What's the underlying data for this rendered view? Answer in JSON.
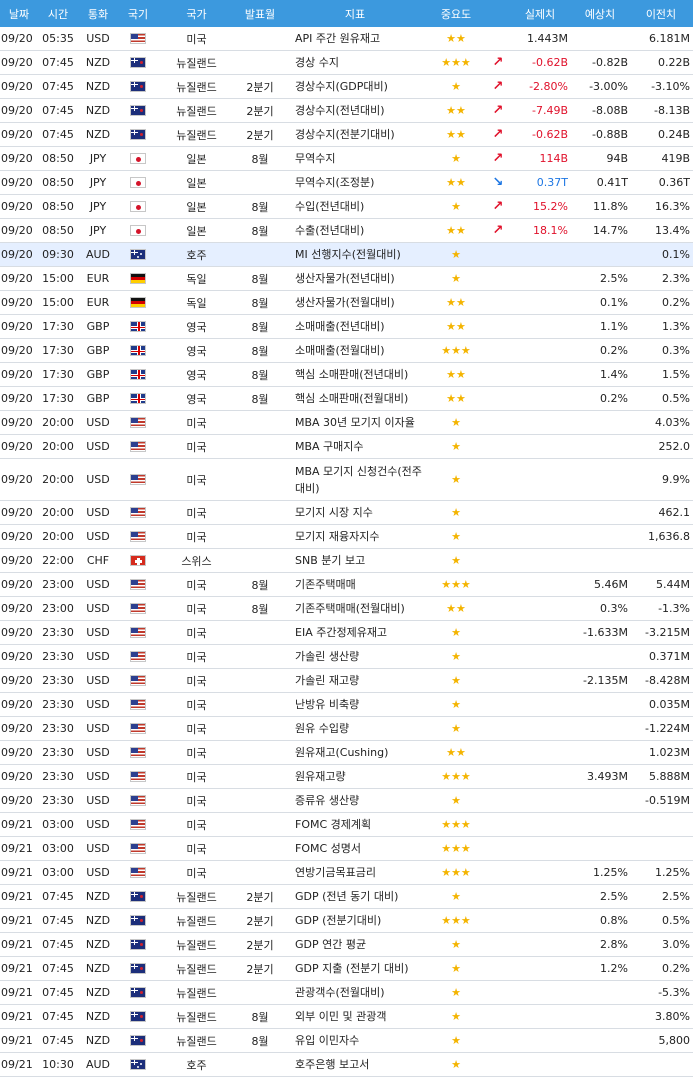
{
  "headers": {
    "date": "날짜",
    "time": "시간",
    "currency": "통화",
    "flag": "국기",
    "country": "국가",
    "period": "발표월",
    "indicator": "지표",
    "importance": "중요도",
    "actual": "실제치",
    "forecast": "예상치",
    "previous": "이전치"
  },
  "colors": {
    "header_bg": "#3c99de",
    "up": "#e0112b",
    "down": "#1d76e3",
    "star": "#f4b400",
    "highlight_row": "#e5efff"
  },
  "rows": [
    {
      "date": "09/20",
      "time": "05:35",
      "cur": "USD",
      "flag": "us-flag",
      "country": "미국",
      "period": "",
      "ind": "API 주간 원유재고",
      "imp": "★★",
      "trend": "",
      "act": "1.443M",
      "fc": "",
      "prev": "6.181M",
      "h": 24
    },
    {
      "date": "09/20",
      "time": "07:45",
      "cur": "NZD",
      "flag": "nz-flag",
      "country": "뉴질랜드",
      "period": "",
      "ind": "경상 수지",
      "imp": "★★★",
      "trend": "up",
      "act": "-0.62B",
      "fc": "-0.82B",
      "prev": "0.22B",
      "h": 24
    },
    {
      "date": "09/20",
      "time": "07:45",
      "cur": "NZD",
      "flag": "nz-flag",
      "country": "뉴질랜드",
      "period": "2분기",
      "ind": "경상수지(GDP대비)",
      "imp": "★",
      "trend": "up",
      "act": "-2.80%",
      "fc": "-3.00%",
      "prev": "-3.10%",
      "h": 24
    },
    {
      "date": "09/20",
      "time": "07:45",
      "cur": "NZD",
      "flag": "nz-flag",
      "country": "뉴질랜드",
      "period": "2분기",
      "ind": "경상수지(전년대비)",
      "imp": "★★",
      "trend": "up",
      "act": "-7.49B",
      "fc": "-8.08B",
      "prev": "-8.13B",
      "h": 24
    },
    {
      "date": "09/20",
      "time": "07:45",
      "cur": "NZD",
      "flag": "nz-flag",
      "country": "뉴질랜드",
      "period": "2분기",
      "ind": "경상수지(전분기대비)",
      "imp": "★★",
      "trend": "up",
      "act": "-0.62B",
      "fc": "-0.88B",
      "prev": "0.24B",
      "h": 24
    },
    {
      "date": "09/20",
      "time": "08:50",
      "cur": "JPY",
      "flag": "jp-flag",
      "country": "일본",
      "period": "8월",
      "ind": "무역수지",
      "imp": "★",
      "trend": "up",
      "act": "114B",
      "fc": "94B",
      "prev": "419B",
      "h": 24
    },
    {
      "date": "09/20",
      "time": "08:50",
      "cur": "JPY",
      "flag": "jp-flag",
      "country": "일본",
      "period": "",
      "ind": "무역수지(조정분)",
      "imp": "★★",
      "trend": "down",
      "act": "0.37T",
      "fc": "0.41T",
      "prev": "0.36T",
      "h": 24
    },
    {
      "date": "09/20",
      "time": "08:50",
      "cur": "JPY",
      "flag": "jp-flag",
      "country": "일본",
      "period": "8월",
      "ind": "수입(전년대비)",
      "imp": "★",
      "trend": "up",
      "act": "15.2%",
      "fc": "11.8%",
      "prev": "16.3%",
      "h": 24
    },
    {
      "date": "09/20",
      "time": "08:50",
      "cur": "JPY",
      "flag": "jp-flag",
      "country": "일본",
      "period": "8월",
      "ind": "수출(전년대비)",
      "imp": "★★",
      "trend": "up",
      "act": "18.1%",
      "fc": "14.7%",
      "prev": "13.4%",
      "h": 24
    },
    {
      "date": "09/20",
      "time": "09:30",
      "cur": "AUD",
      "flag": "au-flag",
      "country": "호주",
      "period": "",
      "ind": "MI 선행지수(전월대비)",
      "imp": "★",
      "trend": "",
      "act": "",
      "fc": "",
      "prev": "0.1%",
      "h": 24,
      "hl": true
    },
    {
      "date": "09/20",
      "time": "15:00",
      "cur": "EUR",
      "flag": "de-flag",
      "country": "독일",
      "period": "8월",
      "ind": "생산자물가(전년대비)",
      "imp": "★",
      "trend": "",
      "act": "",
      "fc": "2.5%",
      "prev": "2.3%",
      "h": 24
    },
    {
      "date": "09/20",
      "time": "15:00",
      "cur": "EUR",
      "flag": "de-flag",
      "country": "독일",
      "period": "8월",
      "ind": "생산자물가(전월대비)",
      "imp": "★★",
      "trend": "",
      "act": "",
      "fc": "0.1%",
      "prev": "0.2%",
      "h": 24
    },
    {
      "date": "09/20",
      "time": "17:30",
      "cur": "GBP",
      "flag": "gb-flag",
      "country": "영국",
      "period": "8월",
      "ind": "소매매출(전년대비)",
      "imp": "★★",
      "trend": "",
      "act": "",
      "fc": "1.1%",
      "prev": "1.3%",
      "h": 24
    },
    {
      "date": "09/20",
      "time": "17:30",
      "cur": "GBP",
      "flag": "gb-flag",
      "country": "영국",
      "period": "8월",
      "ind": "소매매출(전월대비)",
      "imp": "★★★",
      "trend": "",
      "act": "",
      "fc": "0.2%",
      "prev": "0.3%",
      "h": 24
    },
    {
      "date": "09/20",
      "time": "17:30",
      "cur": "GBP",
      "flag": "gb-flag",
      "country": "영국",
      "period": "8월",
      "ind": "핵심 소매판매(전년대비)",
      "imp": "★★",
      "trend": "",
      "act": "",
      "fc": "1.4%",
      "prev": "1.5%",
      "h": 24
    },
    {
      "date": "09/20",
      "time": "17:30",
      "cur": "GBP",
      "flag": "gb-flag",
      "country": "영국",
      "period": "8월",
      "ind": "핵심 소매판매(전월대비)",
      "imp": "★★",
      "trend": "",
      "act": "",
      "fc": "0.2%",
      "prev": "0.5%",
      "h": 24
    },
    {
      "date": "09/20",
      "time": "20:00",
      "cur": "USD",
      "flag": "us-flag",
      "country": "미국",
      "period": "",
      "ind": "MBA 30년 모기지 이자율",
      "imp": "★",
      "trend": "",
      "act": "",
      "fc": "",
      "prev": "4.03%",
      "h": 24
    },
    {
      "date": "09/20",
      "time": "20:00",
      "cur": "USD",
      "flag": "us-flag",
      "country": "미국",
      "period": "",
      "ind": "MBA 구매지수",
      "imp": "★",
      "trend": "",
      "act": "",
      "fc": "",
      "prev": "252.0",
      "h": 24
    },
    {
      "date": "09/20",
      "time": "20:00",
      "cur": "USD",
      "flag": "us-flag",
      "country": "미국",
      "period": "",
      "ind": "MBA 모기지 신청건수(전주대비)",
      "imp": "★",
      "trend": "",
      "act": "",
      "fc": "",
      "prev": "9.9%",
      "h": 42
    },
    {
      "date": "09/20",
      "time": "20:00",
      "cur": "USD",
      "flag": "us-flag",
      "country": "미국",
      "period": "",
      "ind": "모기지 시장 지수",
      "imp": "★",
      "trend": "",
      "act": "",
      "fc": "",
      "prev": "462.1",
      "h": 24
    },
    {
      "date": "09/20",
      "time": "20:00",
      "cur": "USD",
      "flag": "us-flag",
      "country": "미국",
      "period": "",
      "ind": "모기지 재융자지수",
      "imp": "★",
      "trend": "",
      "act": "",
      "fc": "",
      "prev": "1,636.8",
      "h": 24
    },
    {
      "date": "09/20",
      "time": "22:00",
      "cur": "CHF",
      "flag": "ch-flag",
      "country": "스위스",
      "period": "",
      "ind": "SNB 분기 보고",
      "imp": "★",
      "trend": "",
      "act": "",
      "fc": "",
      "prev": "",
      "h": 24
    },
    {
      "date": "09/20",
      "time": "23:00",
      "cur": "USD",
      "flag": "us-flag",
      "country": "미국",
      "period": "8월",
      "ind": "기존주택매매",
      "imp": "★★★",
      "trend": "",
      "act": "",
      "fc": "5.46M",
      "prev": "5.44M",
      "h": 24
    },
    {
      "date": "09/20",
      "time": "23:00",
      "cur": "USD",
      "flag": "us-flag",
      "country": "미국",
      "period": "8월",
      "ind": "기존주택매매(전월대비)",
      "imp": "★★",
      "trend": "",
      "act": "",
      "fc": "0.3%",
      "prev": "-1.3%",
      "h": 24
    },
    {
      "date": "09/20",
      "time": "23:30",
      "cur": "USD",
      "flag": "us-flag",
      "country": "미국",
      "period": "",
      "ind": "EIA 주간정제유재고",
      "imp": "★",
      "trend": "",
      "act": "",
      "fc": "-1.633M",
      "prev": "-3.215M",
      "h": 24
    },
    {
      "date": "09/20",
      "time": "23:30",
      "cur": "USD",
      "flag": "us-flag",
      "country": "미국",
      "period": "",
      "ind": "가솔린 생산량",
      "imp": "★",
      "trend": "",
      "act": "",
      "fc": "",
      "prev": "0.371M",
      "h": 24
    },
    {
      "date": "09/20",
      "time": "23:30",
      "cur": "USD",
      "flag": "us-flag",
      "country": "미국",
      "period": "",
      "ind": "가솔린 재고량",
      "imp": "★",
      "trend": "",
      "act": "",
      "fc": "-2.135M",
      "prev": "-8.428M",
      "h": 24
    },
    {
      "date": "09/20",
      "time": "23:30",
      "cur": "USD",
      "flag": "us-flag",
      "country": "미국",
      "period": "",
      "ind": "난방유 비축량",
      "imp": "★",
      "trend": "",
      "act": "",
      "fc": "",
      "prev": "0.035M",
      "h": 24
    },
    {
      "date": "09/20",
      "time": "23:30",
      "cur": "USD",
      "flag": "us-flag",
      "country": "미국",
      "period": "",
      "ind": "원유 수입량",
      "imp": "★",
      "trend": "",
      "act": "",
      "fc": "",
      "prev": "-1.224M",
      "h": 24
    },
    {
      "date": "09/20",
      "time": "23:30",
      "cur": "USD",
      "flag": "us-flag",
      "country": "미국",
      "period": "",
      "ind": "원유재고(Cushing)",
      "imp": "★★",
      "trend": "",
      "act": "",
      "fc": "",
      "prev": "1.023M",
      "h": 24
    },
    {
      "date": "09/20",
      "time": "23:30",
      "cur": "USD",
      "flag": "us-flag",
      "country": "미국",
      "period": "",
      "ind": "원유재고량",
      "imp": "★★★",
      "trend": "",
      "act": "",
      "fc": "3.493M",
      "prev": "5.888M",
      "h": 24
    },
    {
      "date": "09/20",
      "time": "23:30",
      "cur": "USD",
      "flag": "us-flag",
      "country": "미국",
      "period": "",
      "ind": "증류유 생산량",
      "imp": "★",
      "trend": "",
      "act": "",
      "fc": "",
      "prev": "-0.519M",
      "h": 24
    },
    {
      "date": "09/21",
      "time": "03:00",
      "cur": "USD",
      "flag": "us-flag",
      "country": "미국",
      "period": "",
      "ind": "FOMC 경제계획",
      "imp": "★★★",
      "trend": "",
      "act": "",
      "fc": "",
      "prev": "",
      "h": 24
    },
    {
      "date": "09/21",
      "time": "03:00",
      "cur": "USD",
      "flag": "us-flag",
      "country": "미국",
      "period": "",
      "ind": "FOMC 성명서",
      "imp": "★★★",
      "trend": "",
      "act": "",
      "fc": "",
      "prev": "",
      "h": 24
    },
    {
      "date": "09/21",
      "time": "03:00",
      "cur": "USD",
      "flag": "us-flag",
      "country": "미국",
      "period": "",
      "ind": "연방기금목표금리",
      "imp": "★★★",
      "trend": "",
      "act": "",
      "fc": "1.25%",
      "prev": "1.25%",
      "h": 24
    },
    {
      "date": "09/21",
      "time": "07:45",
      "cur": "NZD",
      "flag": "nz-flag",
      "country": "뉴질랜드",
      "period": "2분기",
      "ind": "GDP (전년 동기 대비)",
      "imp": "★",
      "trend": "",
      "act": "",
      "fc": "2.5%",
      "prev": "2.5%",
      "h": 24
    },
    {
      "date": "09/21",
      "time": "07:45",
      "cur": "NZD",
      "flag": "nz-flag",
      "country": "뉴질랜드",
      "period": "2분기",
      "ind": "GDP (전분기대비)",
      "imp": "★★★",
      "trend": "",
      "act": "",
      "fc": "0.8%",
      "prev": "0.5%",
      "h": 24
    },
    {
      "date": "09/21",
      "time": "07:45",
      "cur": "NZD",
      "flag": "nz-flag",
      "country": "뉴질랜드",
      "period": "2분기",
      "ind": "GDP 연간 평균",
      "imp": "★",
      "trend": "",
      "act": "",
      "fc": "2.8%",
      "prev": "3.0%",
      "h": 24
    },
    {
      "date": "09/21",
      "time": "07:45",
      "cur": "NZD",
      "flag": "nz-flag",
      "country": "뉴질랜드",
      "period": "2분기",
      "ind": "GDP 지출 (전분기 대비)",
      "imp": "★",
      "trend": "",
      "act": "",
      "fc": "1.2%",
      "prev": "0.2%",
      "h": 24
    },
    {
      "date": "09/21",
      "time": "07:45",
      "cur": "NZD",
      "flag": "nz-flag",
      "country": "뉴질랜드",
      "period": "",
      "ind": "관광객수(전월대비)",
      "imp": "★",
      "trend": "",
      "act": "",
      "fc": "",
      "prev": "-5.3%",
      "h": 24
    },
    {
      "date": "09/21",
      "time": "07:45",
      "cur": "NZD",
      "flag": "nz-flag",
      "country": "뉴질랜드",
      "period": "8월",
      "ind": "외부 이민 및 관광객",
      "imp": "★",
      "trend": "",
      "act": "",
      "fc": "",
      "prev": "3.80%",
      "h": 24
    },
    {
      "date": "09/21",
      "time": "07:45",
      "cur": "NZD",
      "flag": "nz-flag",
      "country": "뉴질랜드",
      "period": "8월",
      "ind": "유입 이민자수",
      "imp": "★",
      "trend": "",
      "act": "",
      "fc": "",
      "prev": "5,800",
      "h": 24
    },
    {
      "date": "09/21",
      "time": "10:30",
      "cur": "AUD",
      "flag": "au-flag",
      "country": "호주",
      "period": "",
      "ind": "호주은행 보고서",
      "imp": "★",
      "trend": "",
      "act": "",
      "fc": "",
      "prev": "",
      "h": 24
    }
  ]
}
